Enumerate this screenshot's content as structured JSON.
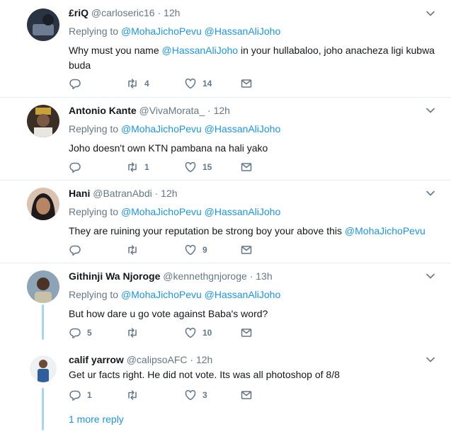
{
  "tweets": [
    {
      "name": "£riQ",
      "handle": "@carloseric16",
      "dot": "·",
      "time": "12h",
      "replying_prefix": "Replying to",
      "reply_mentions": [
        "@MohaJichoPevu",
        "@HassanAliJoho"
      ],
      "text_parts": [
        "Why must you name ",
        "@HassanAliJoho",
        " in your hullabaloo, joho anacheza ligi kubwa buda"
      ],
      "reply_count": "",
      "retweet_count": "4",
      "like_count": "14"
    },
    {
      "name": "Antonio Kante",
      "handle": "@VivaMorata_",
      "dot": "·",
      "time": "12h",
      "replying_prefix": "Replying to",
      "reply_mentions": [
        "@MohaJichoPevu",
        "@HassanAliJoho"
      ],
      "text_parts": [
        "Joho doesn't own KTN pambana na hali yako"
      ],
      "reply_count": "",
      "retweet_count": "1",
      "like_count": "15"
    },
    {
      "name": "Hani",
      "handle": "@BatranAbdi",
      "dot": "·",
      "time": "12h",
      "replying_prefix": "Replying to",
      "reply_mentions": [
        "@MohaJichoPevu",
        "@HassanAliJoho"
      ],
      "text_parts": [
        "They are ruining your reputation be strong boy your above this ",
        "@MohaJichoPevu"
      ],
      "reply_count": "",
      "retweet_count": "",
      "like_count": "9"
    },
    {
      "name": "Githinji Wa Njoroge",
      "handle": "@kennethgnjoroge",
      "dot": "·",
      "time": "13h",
      "replying_prefix": "Replying to",
      "reply_mentions": [
        "@MohaJichoPevu",
        "@HassanAliJoho"
      ],
      "text_parts": [
        "But how dare u go vote against Baba's word?"
      ],
      "reply_count": "5",
      "retweet_count": "",
      "like_count": "10"
    },
    {
      "name": "calif yarrow",
      "handle": "@calipsoAFC",
      "dot": "·",
      "time": "12h",
      "text_parts": [
        "Get ur facts right. He did not vote. Its was all photoshop of 8/8"
      ],
      "reply_count": "1",
      "retweet_count": "",
      "like_count": "3"
    }
  ],
  "more_reply_label": "1 more reply",
  "colors": {
    "link": "#1b95e0",
    "muted": "#657786",
    "thread": "#a7d6f5",
    "divider": "#e6ecf0"
  },
  "icons": [
    "chevron-down-icon",
    "reply-icon",
    "retweet-icon",
    "heart-icon",
    "envelope-icon"
  ]
}
